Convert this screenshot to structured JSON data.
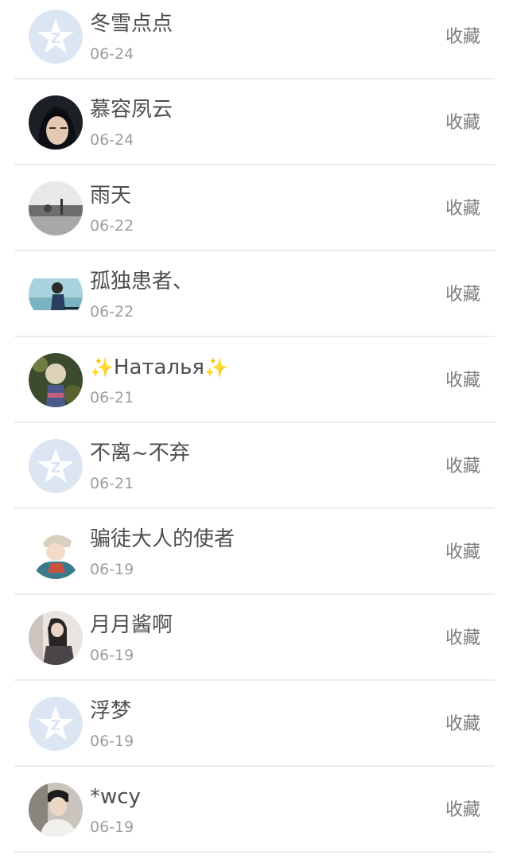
{
  "users": [
    {
      "name": "冬雪点点",
      "date": "06-24",
      "action": "收藏",
      "avatar": "default-qzone-avatar"
    },
    {
      "name": "慕容夙云",
      "date": "06-24",
      "action": "收藏",
      "avatar": "anime-girl-avatar"
    },
    {
      "name": "雨天",
      "date": "06-22",
      "action": "收藏",
      "avatar": "rainy-street-avatar"
    },
    {
      "name": "孤独患者、",
      "date": "06-22",
      "action": "收藏",
      "avatar": "girl-seaside-avatar"
    },
    {
      "name_prefix": "✨",
      "name": "Наталья",
      "name_suffix": "✨",
      "date": "06-21",
      "action": "收藏",
      "avatar": "girl-hat-avatar"
    },
    {
      "name": "不离~不弃",
      "date": "06-21",
      "action": "收藏",
      "avatar": "default-qzone-avatar"
    },
    {
      "name": "骗徒大人的使者",
      "date": "06-19",
      "action": "收藏",
      "avatar": "cartoon-boy-avatar"
    },
    {
      "name": "月月酱啊",
      "date": "06-19",
      "action": "收藏",
      "avatar": "girl-sitting-avatar"
    },
    {
      "name": "浮梦",
      "date": "06-19",
      "action": "收藏",
      "avatar": "default-qzone-avatar"
    },
    {
      "name": "*wcy",
      "date": "06-19",
      "action": "收藏",
      "avatar": "boy-portrait-avatar"
    }
  ]
}
